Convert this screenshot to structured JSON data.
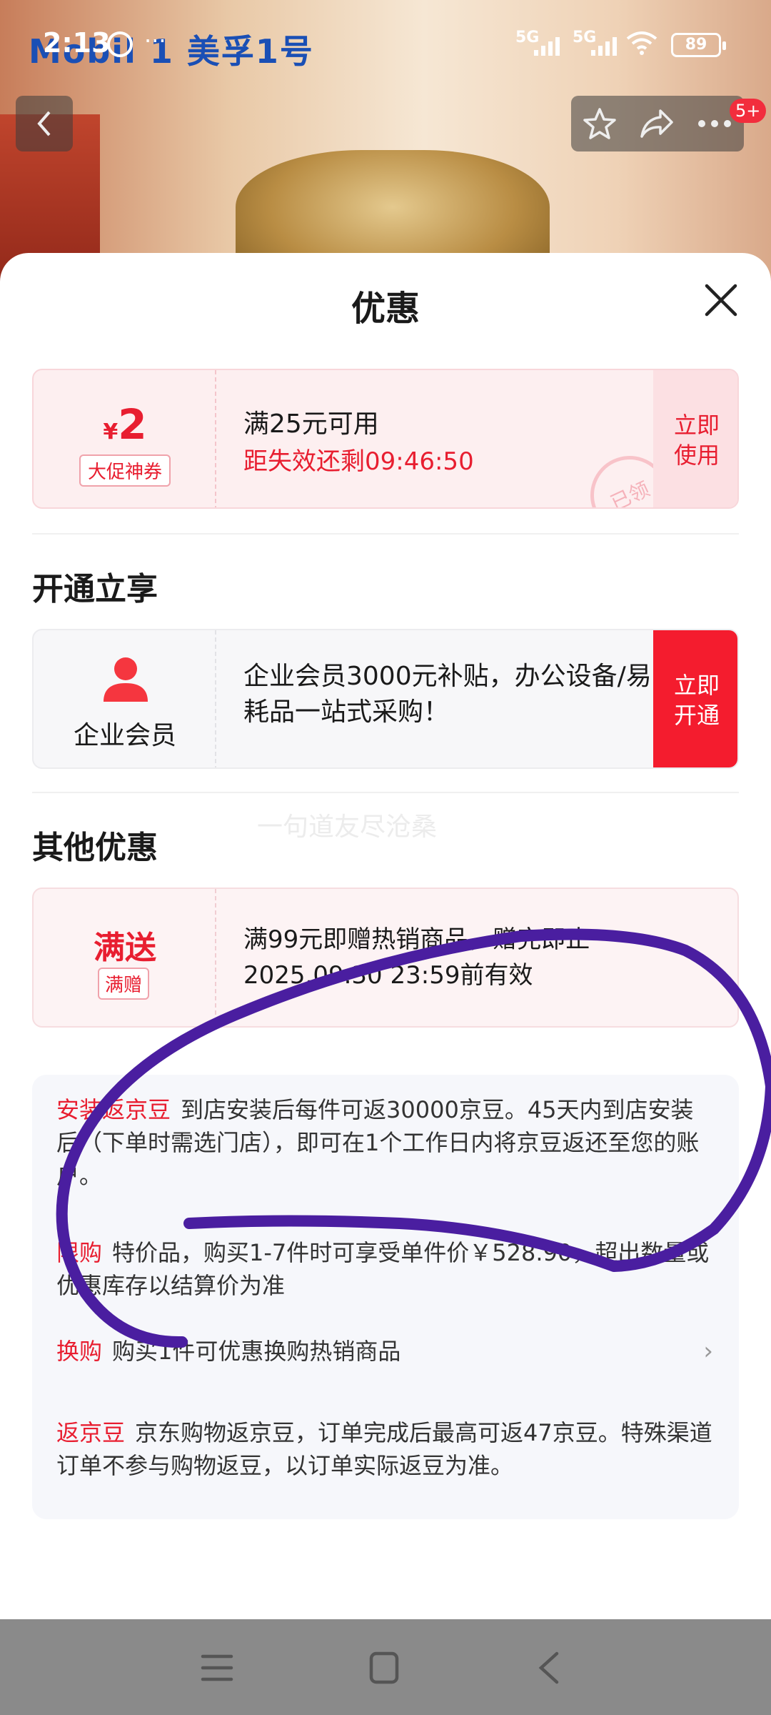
{
  "status_bar": {
    "time": "2:13",
    "overflow": "···",
    "net1": "5G",
    "net2": "5G",
    "battery": "89"
  },
  "banner": {
    "brand": "Mobil 1  美孚1号"
  },
  "nav_top": {
    "badge": "5+"
  },
  "sheet": {
    "title": "优惠",
    "coupon": {
      "yen": "¥",
      "amount": "2",
      "tag": "大促神券",
      "condition": "满25元可用",
      "countdown": "距失效还剩09:46:50",
      "use_label_1": "立即",
      "use_label_2": "使用",
      "stamp": "已领"
    },
    "section_open": "开通立享",
    "member": {
      "label": "企业会员",
      "desc": " 企业会员3000元补贴，办公设备/易耗品一站式采购！",
      "open_label_1": "立即",
      "open_label_2": "开通"
    },
    "watermark": "一句道友尽沧桑",
    "section_other": "其他优惠",
    "gift": {
      "title": "满送",
      "tag": "满赠",
      "desc": "满99元即赠热销商品，赠完即止 2025.09.30 23:59前有效",
      "chevron": "›"
    },
    "info": [
      {
        "key": "安装返京豆",
        "text": "到店安装后每件可返30000京豆。45天内到店安装后（下单时需选门店），即可在1个工作日内将京豆返还至您的账户。"
      },
      {
        "key": "限购",
        "text": "特价品，购买1-7件时可享受单件价￥528.90，超出数量或优惠库存以结算价为准"
      },
      {
        "key": "换购",
        "text": "购买1件可优惠换购热销商品",
        "chevron": "›"
      },
      {
        "key": "返京豆",
        "text": "京东购物返京豆，订单完成后最高可返47京豆。特殊渠道订单不参与购物返豆，以订单实际返豆为准。"
      }
    ]
  },
  "colors": {
    "accent_red": "#e81e30",
    "annotation_purple": "#4a1ea0"
  },
  "icons": [
    "back-arrow-icon",
    "star-icon",
    "share-icon",
    "more-icon",
    "close-icon",
    "person-icon",
    "menu-icon",
    "home-square-icon",
    "back-nav-icon"
  ]
}
